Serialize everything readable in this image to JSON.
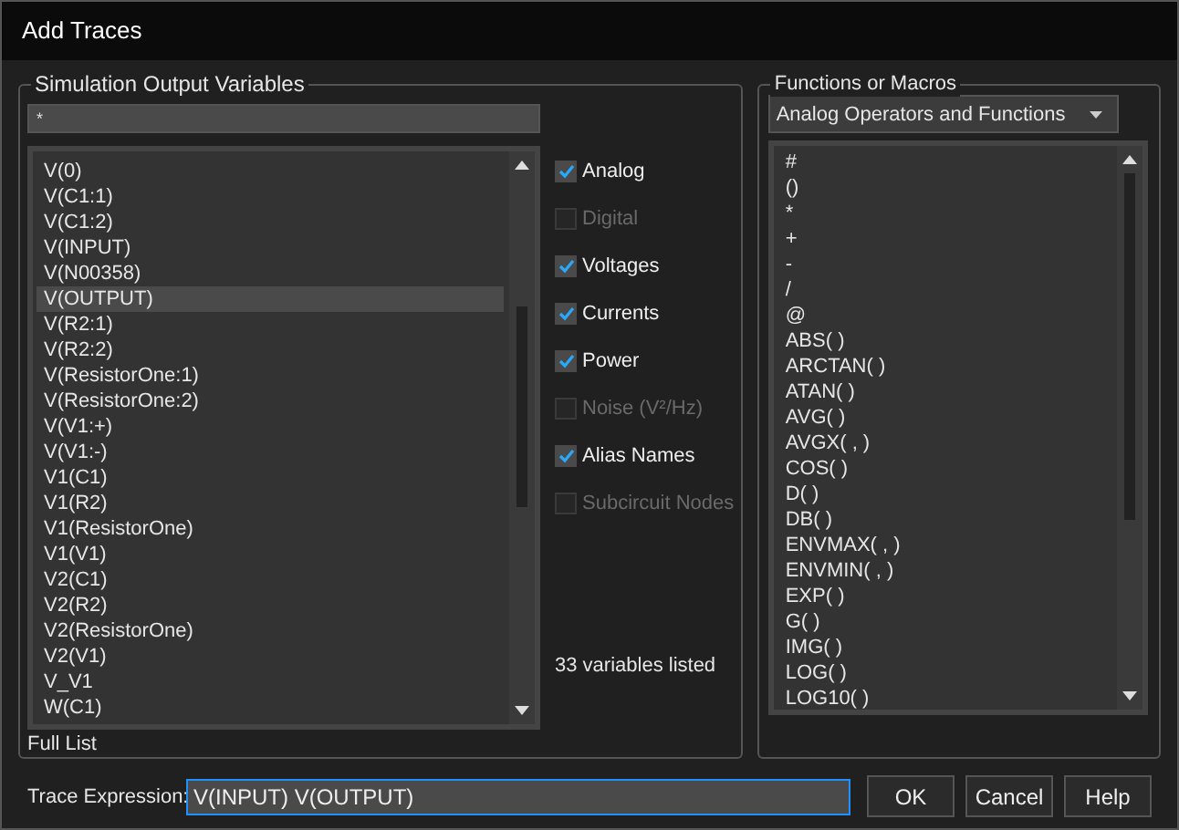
{
  "window": {
    "title": "Add Traces"
  },
  "output_variables": {
    "title": "Simulation Output Variables",
    "filter": "*",
    "items": [
      {
        "label": "V(0)",
        "selected": false
      },
      {
        "label": "V(C1:1)",
        "selected": false
      },
      {
        "label": "V(C1:2)",
        "selected": false
      },
      {
        "label": "V(INPUT)",
        "selected": false
      },
      {
        "label": "V(N00358)",
        "selected": false
      },
      {
        "label": "V(OUTPUT)",
        "selected": true
      },
      {
        "label": "V(R2:1)",
        "selected": false
      },
      {
        "label": "V(R2:2)",
        "selected": false
      },
      {
        "label": "V(ResistorOne:1)",
        "selected": false
      },
      {
        "label": "V(ResistorOne:2)",
        "selected": false
      },
      {
        "label": "V(V1:+)",
        "selected": false
      },
      {
        "label": "V(V1:-)",
        "selected": false
      },
      {
        "label": "V1(C1)",
        "selected": false
      },
      {
        "label": "V1(R2)",
        "selected": false
      },
      {
        "label": "V1(ResistorOne)",
        "selected": false
      },
      {
        "label": "V1(V1)",
        "selected": false
      },
      {
        "label": "V2(C1)",
        "selected": false
      },
      {
        "label": "V2(R2)",
        "selected": false
      },
      {
        "label": "V2(ResistorOne)",
        "selected": false
      },
      {
        "label": "V2(V1)",
        "selected": false
      },
      {
        "label": "V_V1",
        "selected": false
      },
      {
        "label": "W(C1)",
        "selected": false
      }
    ],
    "options": [
      {
        "label": "Analog",
        "checked": true,
        "disabled": false
      },
      {
        "label": "Digital",
        "checked": false,
        "disabled": true
      },
      {
        "label": "Voltages",
        "checked": true,
        "disabled": false
      },
      {
        "label": "Currents",
        "checked": true,
        "disabled": false
      },
      {
        "label": "Power",
        "checked": true,
        "disabled": false
      },
      {
        "label": "Noise (V²/Hz)",
        "checked": false,
        "disabled": true
      },
      {
        "label": "Alias Names",
        "checked": true,
        "disabled": false
      },
      {
        "label": "Subcircuit Nodes",
        "checked": false,
        "disabled": true
      }
    ],
    "count": "33 variables listed",
    "footer": "Full List"
  },
  "functions": {
    "title": "Functions or Macros",
    "category": "Analog Operators and Functions",
    "items": [
      "#",
      "()",
      "*",
      "+",
      "-",
      "/",
      "@",
      "ABS( )",
      "ARCTAN( )",
      "ATAN( )",
      "AVG( )",
      "AVGX( , )",
      "COS( )",
      "D( )",
      "DB( )",
      "ENVMAX( , )",
      "ENVMIN( , )",
      "EXP( )",
      "G( )",
      "IMG( )",
      "LOG( )",
      "LOG10( )"
    ]
  },
  "trace_expression": {
    "label": "Trace Expression:",
    "value": "V(INPUT) V(OUTPUT)"
  },
  "buttons": [
    "OK",
    "Cancel",
    "Help"
  ]
}
